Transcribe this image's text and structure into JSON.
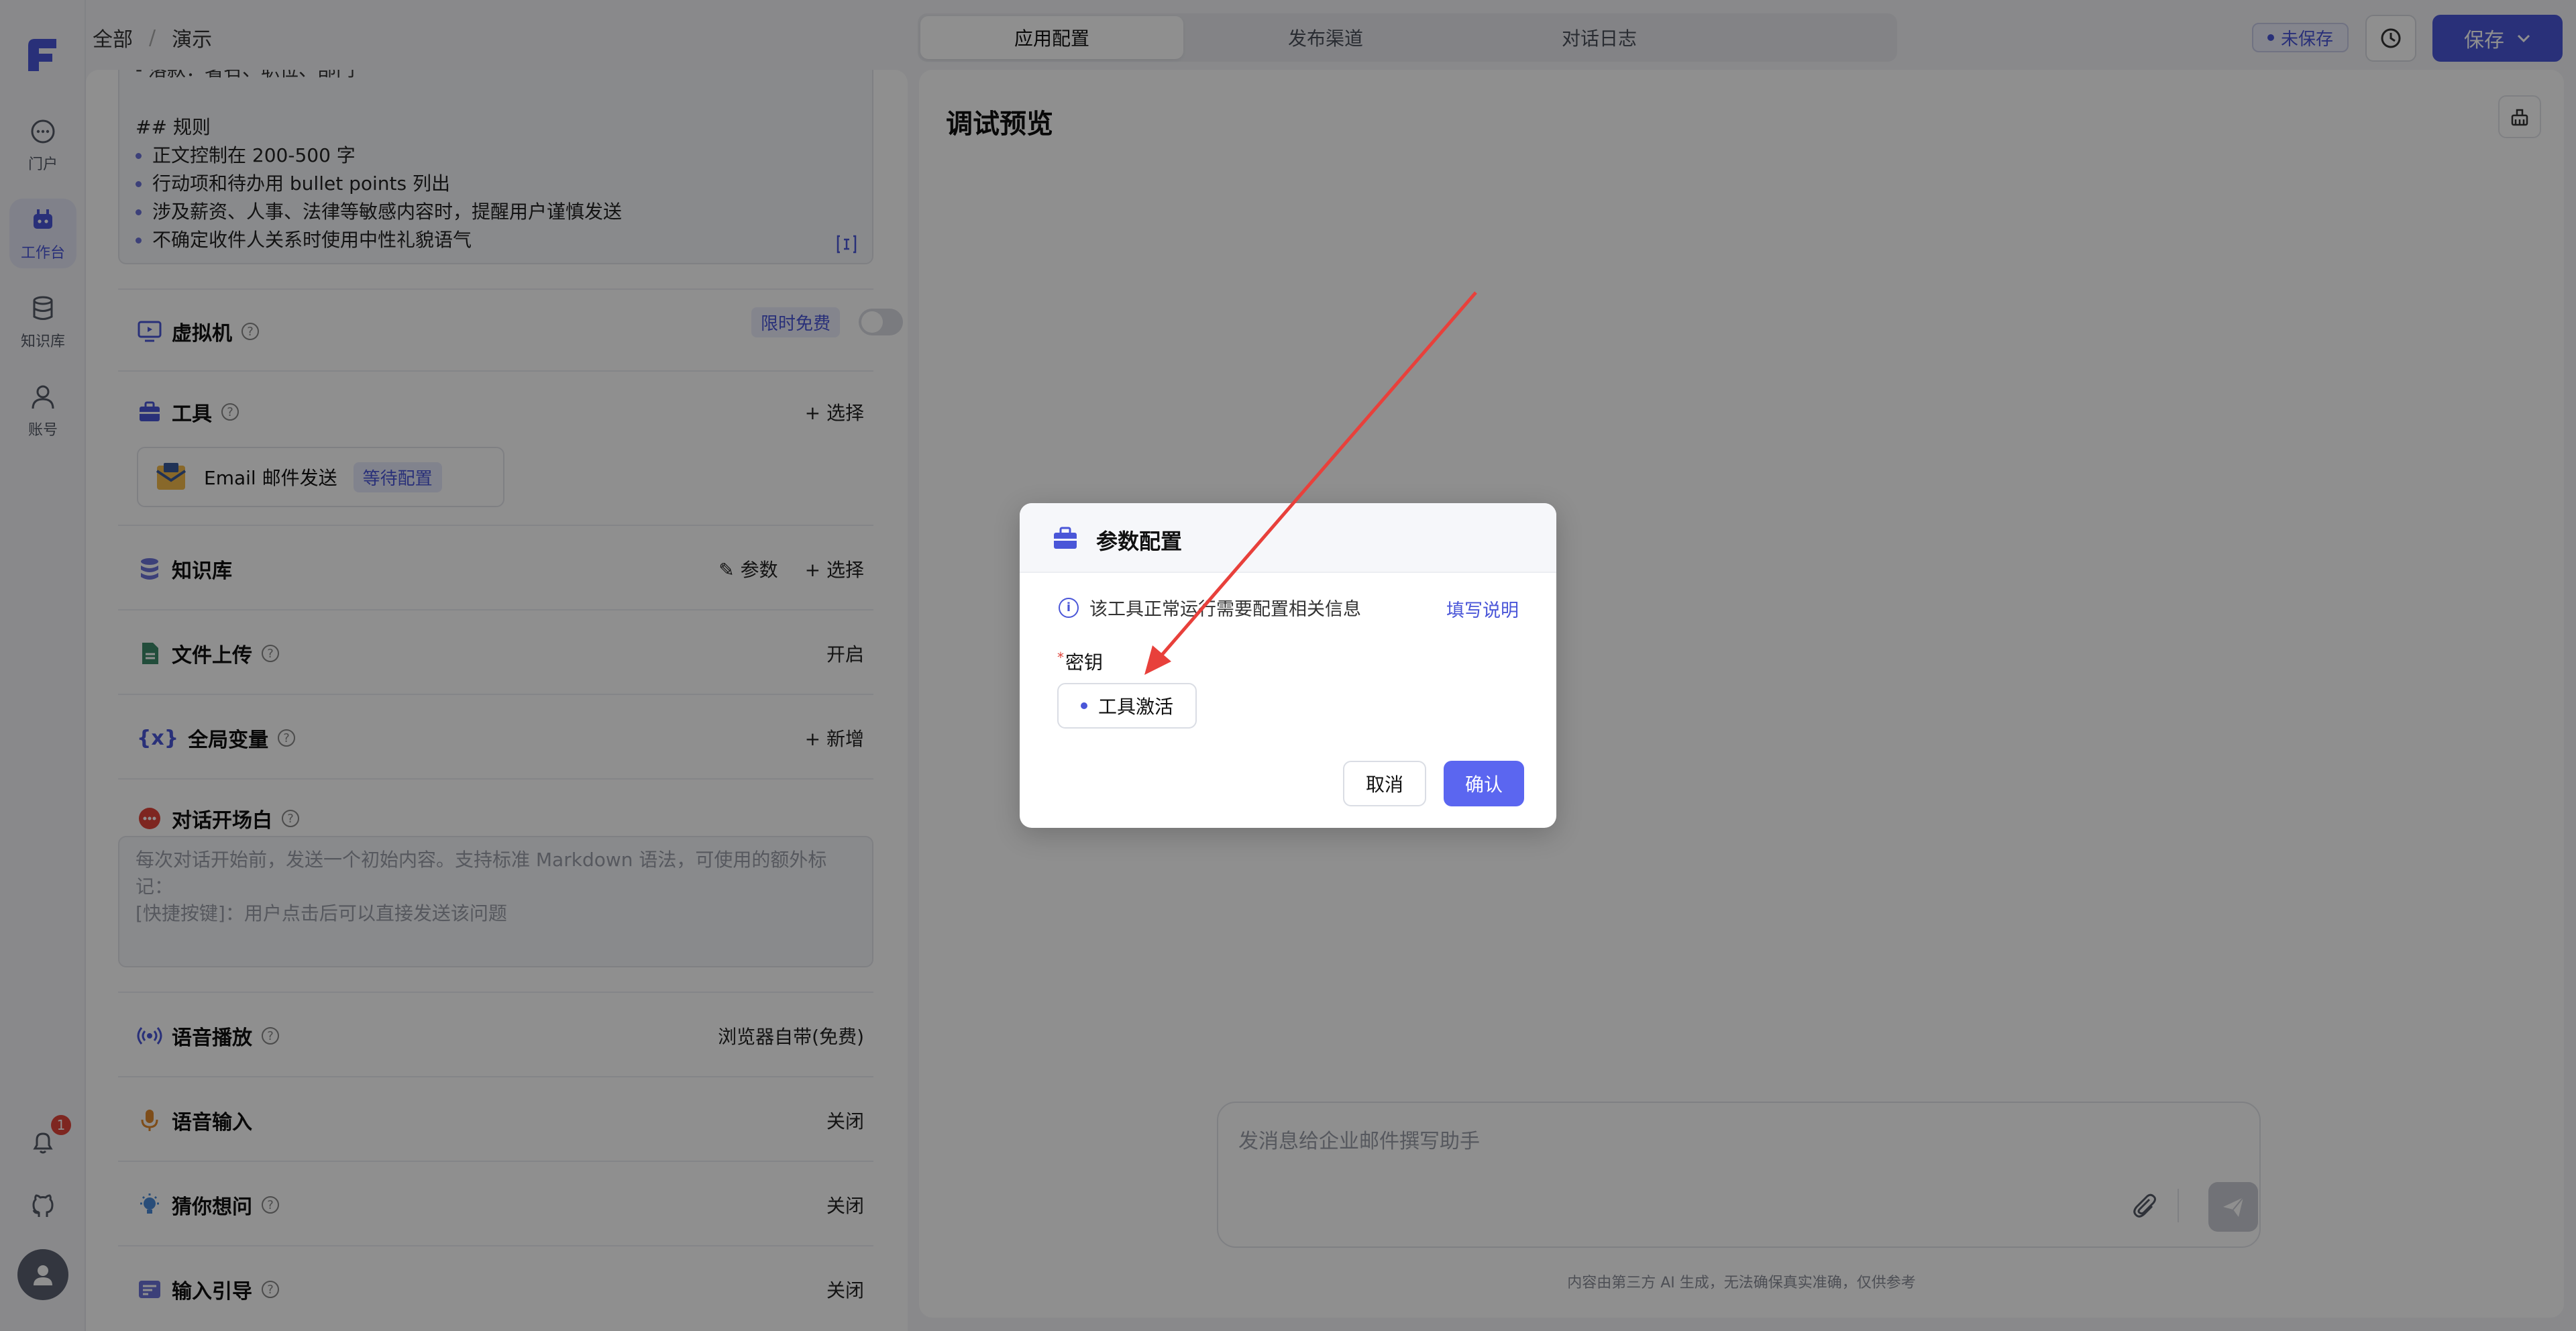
{
  "breadcrumb": [
    "全部",
    "演示"
  ],
  "tabs": [
    "应用配置",
    "发布渠道",
    "对话日志"
  ],
  "status_badge": "未保存",
  "save_label": "保存",
  "rail": {
    "items": [
      "门户",
      "工作台",
      "知识库",
      "账号"
    ],
    "notification_count": "1"
  },
  "prompt": {
    "partial_line": "- 落款：署名、职位、部门",
    "rules_heading": "## 规则",
    "rules": [
      "正文控制在 200-500 字",
      "行动项和待办用 bullet points 列出",
      "涉及薪资、人事、法律等敏感内容时，提醒用户谨慎发送",
      "不确定收件人关系时使用中性礼貌语气"
    ]
  },
  "sections": {
    "vm": {
      "label": "虚拟机",
      "tag": "限时免费"
    },
    "tools": {
      "label": "工具",
      "action": "选择",
      "tool_name": "Email 邮件发送",
      "tool_status": "等待配置"
    },
    "kb": {
      "label": "知识库",
      "param": "参数",
      "action": "选择"
    },
    "upload": {
      "label": "文件上传",
      "value": "开启"
    },
    "vars": {
      "label": "全局变量",
      "action": "新增"
    },
    "opener": {
      "label": "对话开场白",
      "placeholder_1": "每次对话开始前，发送一个初始内容。支持标准 Markdown 语法，可使用的额外标记：",
      "placeholder_2": "[快捷按键]：用户点击后可以直接发送该问题"
    },
    "tts": {
      "label": "语音播放",
      "value": "浏览器自带(免费)"
    },
    "stt": {
      "label": "语音输入",
      "value": "关闭"
    },
    "guess": {
      "label": "猜你想问",
      "value": "关闭"
    },
    "guide": {
      "label": "输入引导",
      "value": "关闭"
    }
  },
  "preview": {
    "title": "调试预览",
    "input_placeholder": "发消息给企业邮件撰写助手",
    "disclaimer": "内容由第三方 AI 生成，无法确保真实准确，仅供参考"
  },
  "modal": {
    "title": "参数配置",
    "info": "该工具正常运行需要配置相关信息",
    "link": "填写说明",
    "field_label": "密钥",
    "chip_label": "工具激活",
    "cancel": "取消",
    "confirm": "确认"
  },
  "colors": {
    "accent": "#4a56d8",
    "confirm": "#5b66f0",
    "arrow": "#e8403b"
  }
}
